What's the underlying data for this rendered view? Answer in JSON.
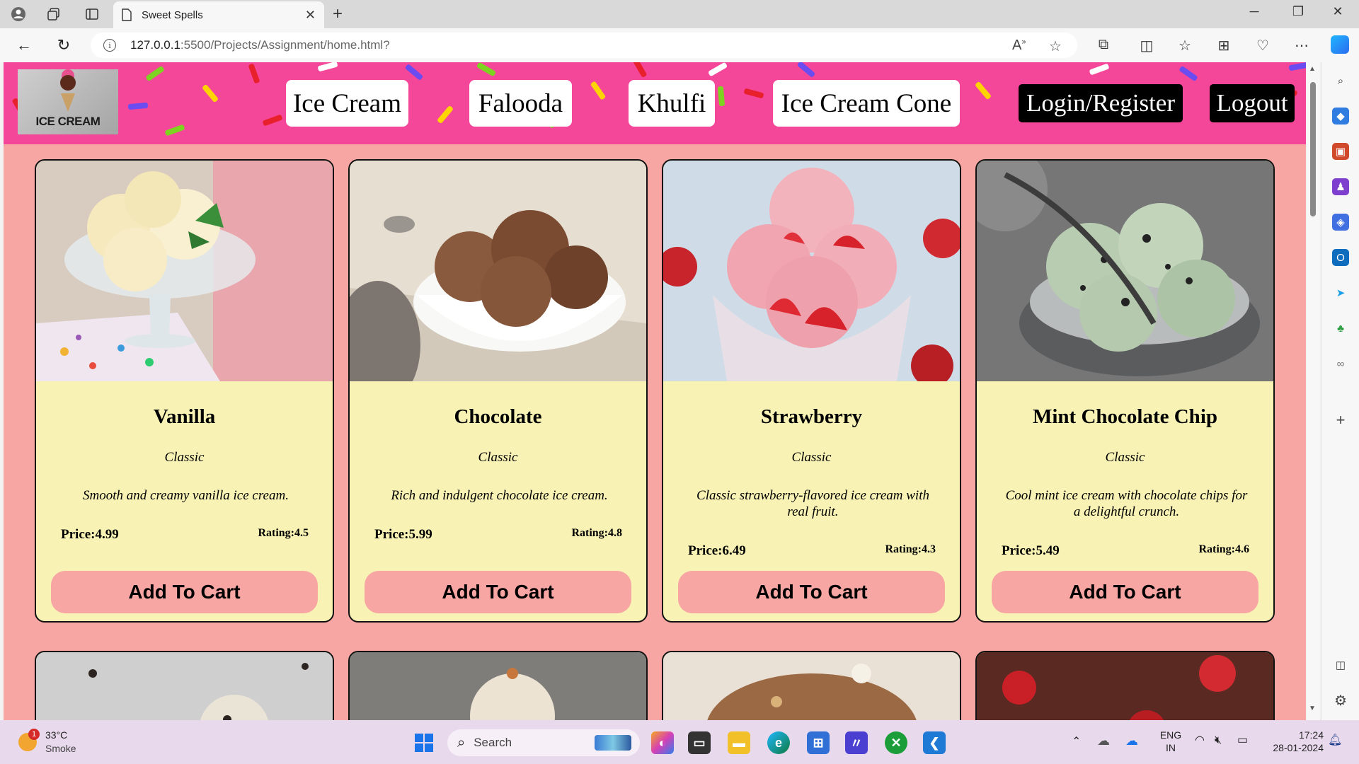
{
  "browser": {
    "tab_title": "Sweet Spells",
    "url_host": "127.0.0.1",
    "url_rest": ":5500/Projects/Assignment/home.html?"
  },
  "site": {
    "logo_text": "ICE CREAM",
    "nav": {
      "ice_cream": "Ice Cream",
      "falooda": "Falooda",
      "khulfi": "Khulfi",
      "ice_cream_cone": "Ice Cream Cone",
      "login_register": "Login/Register",
      "logout": "Logout"
    }
  },
  "products": [
    {
      "name": "Vanilla",
      "category": "Classic",
      "description": "Smooth and creamy vanilla ice cream.",
      "price": "Price:4.99",
      "rating": "Rating:4.5",
      "button": "Add To Cart"
    },
    {
      "name": "Chocolate",
      "category": "Classic",
      "description": "Rich and indulgent chocolate ice cream.",
      "price": "Price:5.99",
      "rating": "Rating:4.8",
      "button": "Add To Cart"
    },
    {
      "name": "Strawberry",
      "category": "Classic",
      "description": "Classic strawberry-flavored ice cream with real fruit.",
      "price": "Price:6.49",
      "rating": "Rating:4.3",
      "button": "Add To Cart"
    },
    {
      "name": "Mint Chocolate Chip",
      "category": "Classic",
      "description": "Cool mint ice cream with chocolate chips for a delightful crunch.",
      "price": "Price:5.49",
      "rating": "Rating:4.6",
      "button": "Add To Cart"
    }
  ],
  "taskbar": {
    "weather_temp": "33°C",
    "weather_desc": "Smoke",
    "weather_badge": "1",
    "search_label": "Search",
    "lang_1": "ENG",
    "lang_2": "IN",
    "time": "17:24",
    "date": "28-01-2024"
  },
  "colors": {
    "header_pink": "#f5479a",
    "page_bg": "#f7a6a4",
    "card_bg": "#f8f2b4",
    "button_bg": "#f7a6a4"
  }
}
